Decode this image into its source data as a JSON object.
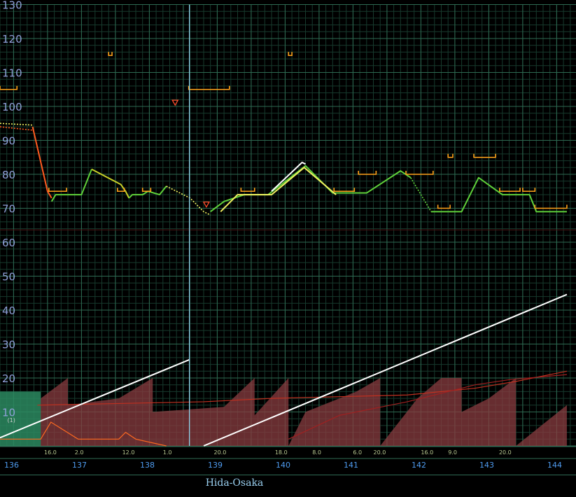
{
  "chart_data": {
    "type": "line",
    "title": "",
    "xlabel": "",
    "ylabel": "",
    "xlim": [
      136,
      144.35
    ],
    "ylim": [
      0,
      130
    ],
    "y_ticks": [
      10,
      20,
      30,
      40,
      50,
      60,
      70,
      80,
      90,
      100,
      110,
      120,
      130
    ],
    "x_ticks": [
      136,
      137,
      138,
      139,
      140,
      141,
      142,
      143,
      144
    ],
    "grid": true,
    "cursor_x": 138.79,
    "series": [
      {
        "name": "",
        "style": "solid",
        "color": "#ff5a1f",
        "points": [
          [
            136.48,
            94
          ],
          [
            136.7,
            75
          ],
          [
            136.76,
            73
          ]
        ]
      },
      {
        "name": "",
        "style": "dotted",
        "color": "#f0f060",
        "points": [
          [
            136.0,
            95
          ],
          [
            136.48,
            94.5
          ]
        ]
      },
      {
        "name": "",
        "style": "dotted",
        "color": "#ff5a1f",
        "points": [
          [
            136.0,
            94
          ],
          [
            136.48,
            93
          ]
        ]
      },
      {
        "name": "",
        "style": "solid",
        "color": "#5fd13a",
        "points": [
          [
            136.76,
            72
          ],
          [
            136.82,
            74
          ],
          [
            137.2,
            74
          ],
          [
            137.35,
            81.5
          ]
        ]
      },
      {
        "name": "",
        "style": "solid",
        "color": "#c8d028",
        "points": [
          [
            137.35,
            81.5
          ],
          [
            137.78,
            77
          ],
          [
            137.85,
            75
          ],
          [
            137.9,
            73
          ]
        ]
      },
      {
        "name": "",
        "style": "solid",
        "color": "#5fd13a",
        "points": [
          [
            137.9,
            73
          ],
          [
            137.95,
            74
          ],
          [
            138.1,
            74
          ],
          [
            138.18,
            75
          ],
          [
            138.35,
            74
          ],
          [
            138.45,
            76.5
          ]
        ]
      },
      {
        "name": "",
        "style": "dotted",
        "color": "#f0f060",
        "points": [
          [
            138.45,
            76.5
          ],
          [
            138.8,
            73
          ],
          [
            139.0,
            69
          ],
          [
            139.1,
            68
          ]
        ]
      },
      {
        "name": "",
        "style": "solid",
        "color": "#5fd13a",
        "points": [
          [
            139.1,
            69
          ],
          [
            139.3,
            72
          ],
          [
            139.6,
            74
          ],
          [
            139.95,
            74
          ],
          [
            140.5,
            82.5
          ],
          [
            140.9,
            74.5
          ],
          [
            141.4,
            74.5
          ],
          [
            141.9,
            81
          ],
          [
            142.05,
            79
          ]
        ]
      },
      {
        "name": "",
        "style": "solid",
        "color": "#f0f060",
        "points": [
          [
            139.25,
            69
          ],
          [
            139.5,
            74
          ],
          [
            140.0,
            74
          ],
          [
            140.48,
            82
          ],
          [
            140.95,
            74
          ]
        ]
      },
      {
        "name": "",
        "style": "solid",
        "color": "#ffffff",
        "points": [
          [
            140.0,
            75
          ],
          [
            140.45,
            83.5
          ],
          [
            140.5,
            83
          ]
        ]
      },
      {
        "name": "",
        "style": "dotted",
        "color": "#5fd13a",
        "points": [
          [
            142.05,
            79
          ],
          [
            142.35,
            69
          ]
        ]
      },
      {
        "name": "",
        "style": "solid",
        "color": "#5fd13a",
        "points": [
          [
            142.35,
            69
          ],
          [
            142.8,
            69
          ],
          [
            143.05,
            79
          ],
          [
            143.4,
            74
          ],
          [
            143.8,
            74
          ],
          [
            143.9,
            69
          ],
          [
            144.35,
            69
          ]
        ]
      },
      {
        "name": "",
        "style": "solid",
        "color": "#ffffff",
        "points": [
          [
            136.0,
            2.4
          ],
          [
            138.79,
            25.4
          ]
        ]
      },
      {
        "name": "",
        "style": "solid",
        "color": "#ffffff",
        "points": [
          [
            139.0,
            0
          ],
          [
            144.35,
            44.6
          ]
        ]
      }
    ],
    "limit_markers": [
      [
        136.0,
        136.25,
        105
      ],
      [
        136.72,
        136.98,
        75
      ],
      [
        137.6,
        137.65,
        115
      ],
      [
        137.73,
        137.83,
        75
      ],
      [
        138.1,
        138.22,
        75
      ],
      [
        138.78,
        139.38,
        105
      ],
      [
        139.55,
        139.75,
        75
      ],
      [
        140.25,
        140.3,
        115
      ],
      [
        140.92,
        141.22,
        75
      ],
      [
        141.28,
        141.54,
        80
      ],
      [
        141.98,
        142.38,
        80
      ],
      [
        142.45,
        142.63,
        70
      ],
      [
        142.6,
        142.67,
        85
      ],
      [
        142.98,
        143.3,
        85
      ],
      [
        143.36,
        143.66,
        75
      ],
      [
        143.7,
        143.88,
        75
      ],
      [
        143.88,
        144.35,
        70
      ]
    ],
    "markers": [
      [
        138.58,
        101,
        "down-triangle"
      ],
      [
        139.04,
        71,
        "down-triangle"
      ]
    ],
    "lower_area": {
      "green_block": {
        "x": [
          136.0,
          136.6
        ],
        "y": [
          0,
          16
        ]
      },
      "red_sawtooth": [
        [
          136.6,
          14
        ],
        [
          137.0,
          20
        ],
        [
          137.0,
          12
        ],
        [
          137.75,
          14
        ],
        [
          138.25,
          20
        ],
        [
          138.25,
          10
        ],
        [
          139.3,
          11.5
        ],
        [
          139.75,
          20
        ],
        [
          139.75,
          9
        ],
        [
          140.25,
          20
        ],
        [
          140.25,
          0
        ],
        [
          140.5,
          10
        ],
        [
          141.25,
          16
        ],
        [
          141.6,
          20
        ],
        [
          141.6,
          0
        ],
        [
          142.15,
          14
        ],
        [
          142.5,
          20
        ],
        [
          142.8,
          20
        ],
        [
          142.8,
          10
        ],
        [
          143.2,
          14
        ],
        [
          143.6,
          20
        ],
        [
          143.6,
          0
        ],
        [
          144.35,
          12
        ]
      ],
      "red_lines": [
        {
          "color": "#ff6a20",
          "points": [
            [
              136.0,
              2
            ],
            [
              136.6,
              2
            ],
            [
              136.75,
              7
            ],
            [
              137.15,
              2
            ],
            [
              137.75,
              2
            ],
            [
              137.85,
              4
            ],
            [
              138.0,
              2
            ],
            [
              138.45,
              0
            ]
          ]
        },
        {
          "color": "#c03020",
          "points": [
            [
              136.55,
              12
            ],
            [
              139.0,
              13
            ],
            [
              140.0,
              14
            ],
            [
              141.0,
              14.5
            ],
            [
              142.0,
              15
            ],
            [
              143.0,
              17
            ],
            [
              143.6,
              19
            ],
            [
              144.35,
              22
            ]
          ]
        },
        {
          "color": "#a02020",
          "points": [
            [
              140.25,
              2
            ],
            [
              141.0,
              9
            ],
            [
              142.0,
              13
            ],
            [
              143.0,
              18
            ],
            [
              143.5,
              19.5
            ],
            [
              144.35,
              21
            ]
          ]
        }
      ]
    },
    "small_labels": [
      {
        "x": 136.65,
        "text": "16.0"
      },
      {
        "x": 137.1,
        "text": "2.0"
      },
      {
        "x": 137.8,
        "text": "12.0"
      },
      {
        "x": 138.4,
        "text": "1.0"
      },
      {
        "x": 139.15,
        "text": "20.0"
      },
      {
        "x": 140.05,
        "text": "18.0"
      },
      {
        "x": 140.6,
        "text": "8.0"
      },
      {
        "x": 141.2,
        "text": "6.0"
      },
      {
        "x": 141.5,
        "text": "20.0"
      },
      {
        "x": 142.2,
        "text": "16.0"
      },
      {
        "x": 142.6,
        "text": "9.0"
      },
      {
        "x": 143.35,
        "text": "20.0"
      }
    ],
    "paren_label": "(1)",
    "paren_label_pos": [
      136.15,
      7
    ]
  },
  "footer": {
    "route": "Hida-Osaka"
  },
  "colors": {
    "grid_major": "#2e6a52",
    "grid_minor": "#173a2d",
    "axis_text": "#8fa0d8",
    "x_text": "#4f9cf0",
    "limit": "#ffa21a",
    "cursor": "#8fd0e8"
  }
}
